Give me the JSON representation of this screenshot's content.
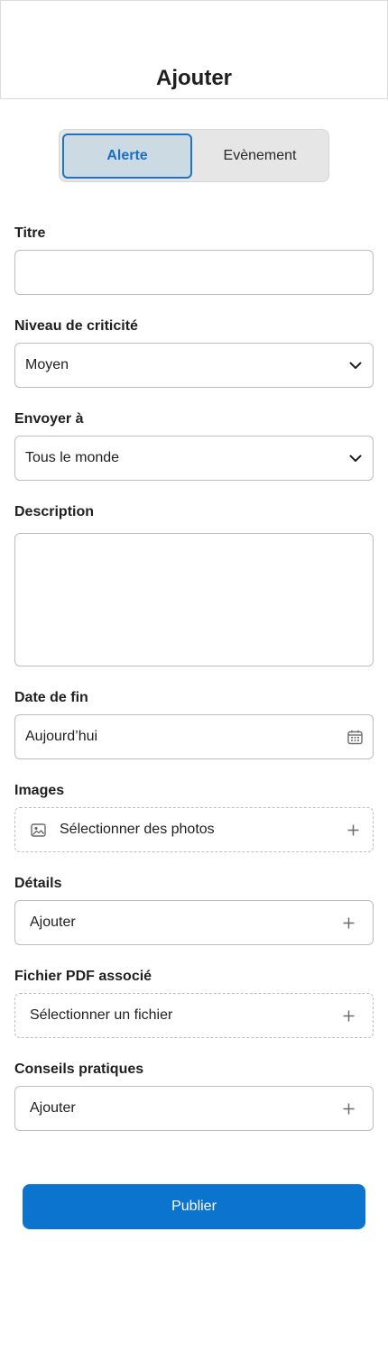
{
  "header": {
    "title": "Ajouter"
  },
  "segmented": {
    "options": [
      "Alerte",
      "Evènement"
    ],
    "selected": "Alerte"
  },
  "form": {
    "title": {
      "label": "Titre",
      "value": ""
    },
    "criticality": {
      "label": "Niveau de criticité",
      "value": "Moyen",
      "icon": "chevron-down-icon"
    },
    "send_to": {
      "label": "Envoyer à",
      "value": "Tous le monde",
      "icon": "chevron-down-icon"
    },
    "description": {
      "label": "Description",
      "value": ""
    },
    "end_date": {
      "label": "Date de fin",
      "value": "Aujourd’hui",
      "icon": "calendar-icon"
    },
    "images": {
      "label": "Images",
      "value": "Sélectionner des photos",
      "icon": "image-icon",
      "action_icon": "plus-icon"
    },
    "details": {
      "label": "Détails",
      "value": "Ajouter",
      "action_icon": "plus-icon"
    },
    "pdf": {
      "label": "Fichier PDF associé",
      "value": "Sélectionner un fichier",
      "action_icon": "plus-icon"
    },
    "tips": {
      "label": "Conseils pratiques",
      "value": "Ajouter",
      "action_icon": "plus-icon"
    }
  },
  "actions": {
    "publish_label": "Publier"
  },
  "colors": {
    "primary": "#0a74cf",
    "segment_active_bg": "#ccdae3",
    "segment_bg": "#e6e6e6",
    "border": "#bdbdbd"
  }
}
